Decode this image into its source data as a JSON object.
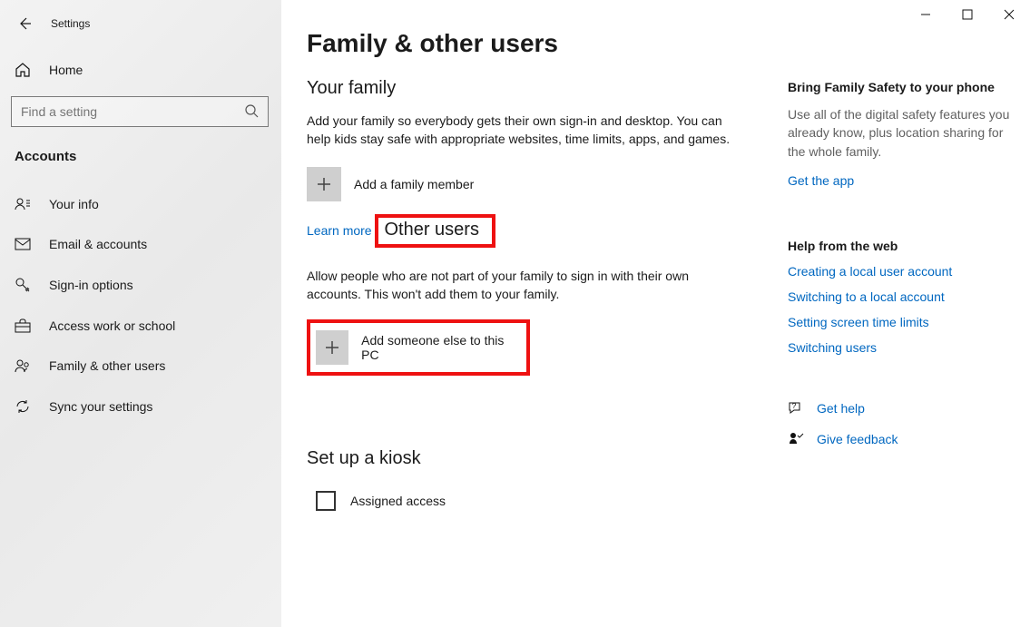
{
  "app_title": "Settings",
  "window_controls": {
    "min": "—",
    "max": "☐",
    "close": "✕"
  },
  "sidebar": {
    "home": "Home",
    "search_placeholder": "Find a setting",
    "section": "Accounts",
    "items": [
      {
        "label": "Your info"
      },
      {
        "label": "Email & accounts"
      },
      {
        "label": "Sign-in options"
      },
      {
        "label": "Access work or school"
      },
      {
        "label": "Family & other users"
      },
      {
        "label": "Sync your settings"
      }
    ]
  },
  "main": {
    "title": "Family & other users",
    "family": {
      "heading": "Your family",
      "desc": "Add your family so everybody gets their own sign-in and desktop. You can help kids stay safe with appropriate websites, time limits, apps, and games.",
      "add_label": "Add a family member",
      "learn_more": "Learn more"
    },
    "other": {
      "heading": "Other users",
      "desc": "Allow people who are not part of your family to sign in with their own accounts. This won't add them to your family.",
      "add_label": "Add someone else to this PC"
    },
    "kiosk": {
      "heading": "Set up a kiosk",
      "assigned": "Assigned access"
    }
  },
  "right": {
    "family_safety": {
      "heading": "Bring Family Safety to your phone",
      "desc": "Use all of the digital safety features you already know, plus location sharing for the whole family.",
      "link": "Get the app"
    },
    "help_web": {
      "heading": "Help from the web",
      "links": [
        "Creating a local user account",
        "Switching to a local account",
        "Setting screen time limits",
        "Switching users"
      ]
    },
    "get_help": "Get help",
    "give_feedback": "Give feedback"
  }
}
